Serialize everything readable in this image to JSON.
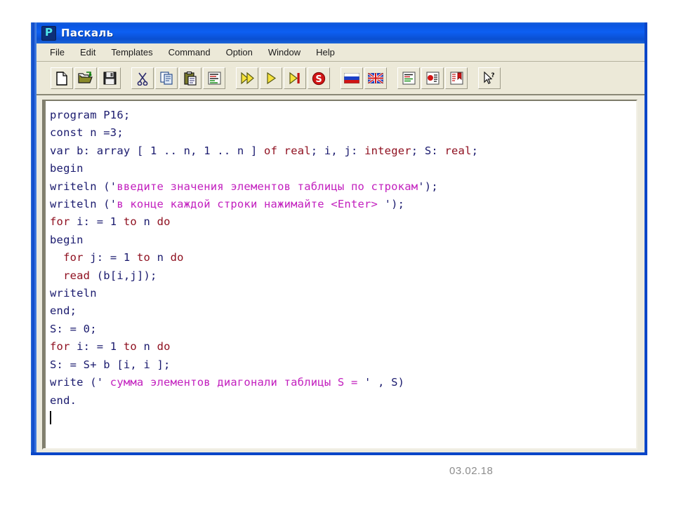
{
  "window": {
    "title": "Паскаль",
    "icon": "pascal-logo-icon",
    "icon_glyph": "P",
    "titlebar_color": "#0d5ff2"
  },
  "menu": {
    "items": [
      {
        "label": "File",
        "name": "menu-file"
      },
      {
        "label": "Edit",
        "name": "menu-edit"
      },
      {
        "label": "Templates",
        "name": "menu-templates"
      },
      {
        "label": "Command",
        "name": "menu-command"
      },
      {
        "label": "Option",
        "name": "menu-option"
      },
      {
        "label": "Window",
        "name": "menu-window"
      },
      {
        "label": "Help",
        "name": "menu-help"
      }
    ]
  },
  "toolbar": {
    "groups": [
      {
        "buttons": [
          {
            "icon": "new-file-icon",
            "tooltip": "New"
          },
          {
            "icon": "open-folder-icon",
            "tooltip": "Open"
          },
          {
            "icon": "save-disk-icon",
            "tooltip": "Save"
          }
        ]
      },
      {
        "buttons": [
          {
            "icon": "cut-scissors-icon",
            "tooltip": "Cut"
          },
          {
            "icon": "copy-icon",
            "tooltip": "Copy"
          },
          {
            "icon": "paste-clipboard-icon",
            "tooltip": "Paste"
          },
          {
            "icon": "format-lines-icon",
            "tooltip": "Format"
          }
        ]
      },
      {
        "buttons": [
          {
            "icon": "run-fast-forward-icon",
            "tooltip": "Run"
          },
          {
            "icon": "play-step-icon",
            "tooltip": "Step"
          },
          {
            "icon": "run-to-end-icon",
            "tooltip": "Run to end"
          },
          {
            "icon": "stop-sign-icon",
            "tooltip": "Stop"
          }
        ]
      },
      {
        "buttons": [
          {
            "icon": "russian-flag-icon",
            "tooltip": "Russian"
          },
          {
            "icon": "uk-flag-icon",
            "tooltip": "English"
          }
        ]
      },
      {
        "buttons": [
          {
            "icon": "document-lines-icon",
            "tooltip": "Document"
          },
          {
            "icon": "document-stop-icon",
            "tooltip": "Breakpoint"
          },
          {
            "icon": "document-bookmark-icon",
            "tooltip": "Bookmark"
          }
        ]
      },
      {
        "buttons": [
          {
            "icon": "help-pointer-icon",
            "tooltip": "Context help"
          }
        ]
      }
    ]
  },
  "editor": {
    "colors": {
      "normal": "#1a1a6e",
      "keyword": "#8f1020",
      "string": "#c21fbe",
      "background": "#ffffff"
    },
    "lines": [
      [
        {
          "t": "nrm",
          "s": "program P16;"
        }
      ],
      [
        {
          "t": "nrm",
          "s": "const n =3;"
        }
      ],
      [
        {
          "t": "nrm",
          "s": "var b: array [ 1 .. n, 1 .. n ] "
        },
        {
          "t": "kw",
          "s": "of"
        },
        {
          "t": "nrm",
          "s": " "
        },
        {
          "t": "kw",
          "s": "real"
        },
        {
          "t": "nrm",
          "s": "; i, j: "
        },
        {
          "t": "kw",
          "s": "integer"
        },
        {
          "t": "nrm",
          "s": "; S: "
        },
        {
          "t": "kw",
          "s": "real"
        },
        {
          "t": "nrm",
          "s": ";"
        }
      ],
      [
        {
          "t": "nrm",
          "s": "begin"
        }
      ],
      [
        {
          "t": "nrm",
          "s": "writeln ('"
        },
        {
          "t": "str",
          "s": "введите значения элементов таблицы по строкам"
        },
        {
          "t": "nrm",
          "s": "');"
        }
      ],
      [
        {
          "t": "nrm",
          "s": "writeln ('"
        },
        {
          "t": "str",
          "s": "в конце каждой строки нажимайте <Enter> "
        },
        {
          "t": "nrm",
          "s": "');"
        }
      ],
      [
        {
          "t": "kw",
          "s": "for"
        },
        {
          "t": "nrm",
          "s": " i: = 1 "
        },
        {
          "t": "kw",
          "s": "to"
        },
        {
          "t": "nrm",
          "s": " n "
        },
        {
          "t": "kw",
          "s": "do"
        }
      ],
      [
        {
          "t": "nrm",
          "s": "begin"
        }
      ],
      [
        {
          "t": "nrm",
          "s": "  "
        },
        {
          "t": "kw",
          "s": "for"
        },
        {
          "t": "nrm",
          "s": " j: = 1 "
        },
        {
          "t": "kw",
          "s": "to"
        },
        {
          "t": "nrm",
          "s": " n "
        },
        {
          "t": "kw",
          "s": "do"
        }
      ],
      [
        {
          "t": "nrm",
          "s": "  "
        },
        {
          "t": "kw",
          "s": "read"
        },
        {
          "t": "nrm",
          "s": " (b[i,j]);"
        }
      ],
      [
        {
          "t": "nrm",
          "s": "writeln"
        }
      ],
      [
        {
          "t": "nrm",
          "s": "end;"
        }
      ],
      [
        {
          "t": "nrm",
          "s": "S: = 0;"
        }
      ],
      [
        {
          "t": "kw",
          "s": "for"
        },
        {
          "t": "nrm",
          "s": " i: = 1 "
        },
        {
          "t": "kw",
          "s": "to"
        },
        {
          "t": "nrm",
          "s": " n "
        },
        {
          "t": "kw",
          "s": "do"
        }
      ],
      [
        {
          "t": "nrm",
          "s": "S: = S+ b [i, i ];"
        }
      ],
      [
        {
          "t": "nrm",
          "s": "write (' "
        },
        {
          "t": "str",
          "s": "сумма элементов диагонали таблицы S = "
        },
        {
          "t": "nrm",
          "s": "' , S)"
        }
      ],
      [
        {
          "t": "nrm",
          "s": "end."
        }
      ]
    ]
  },
  "footer": {
    "date": "03.02.18"
  }
}
